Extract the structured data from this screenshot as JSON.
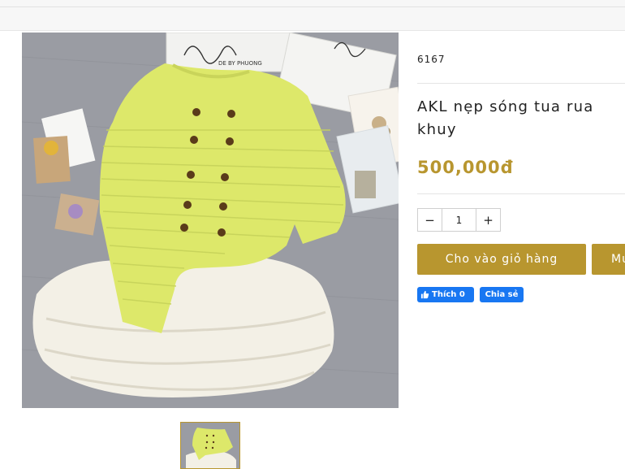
{
  "product": {
    "sku": "6167",
    "title_line1": "AKL nẹp sóng tua rua",
    "title_line2": "khuy",
    "price": "500,000đ"
  },
  "quantity": {
    "minus": "−",
    "value": "1",
    "plus": "+"
  },
  "actions": {
    "add_to_cart": "Cho vào giỏ hàng",
    "buy_now": "Mua"
  },
  "social": {
    "like_label": "Thích 0",
    "share_label": "Chia sẻ"
  },
  "gallery": {
    "box_text": "DE BY PHUONG"
  },
  "colors": {
    "accent": "#b8962f",
    "facebook": "#1877f2",
    "sweater": "#dde86a",
    "skirt": "#f3f0e6",
    "carpet": "#9a9ca3"
  }
}
